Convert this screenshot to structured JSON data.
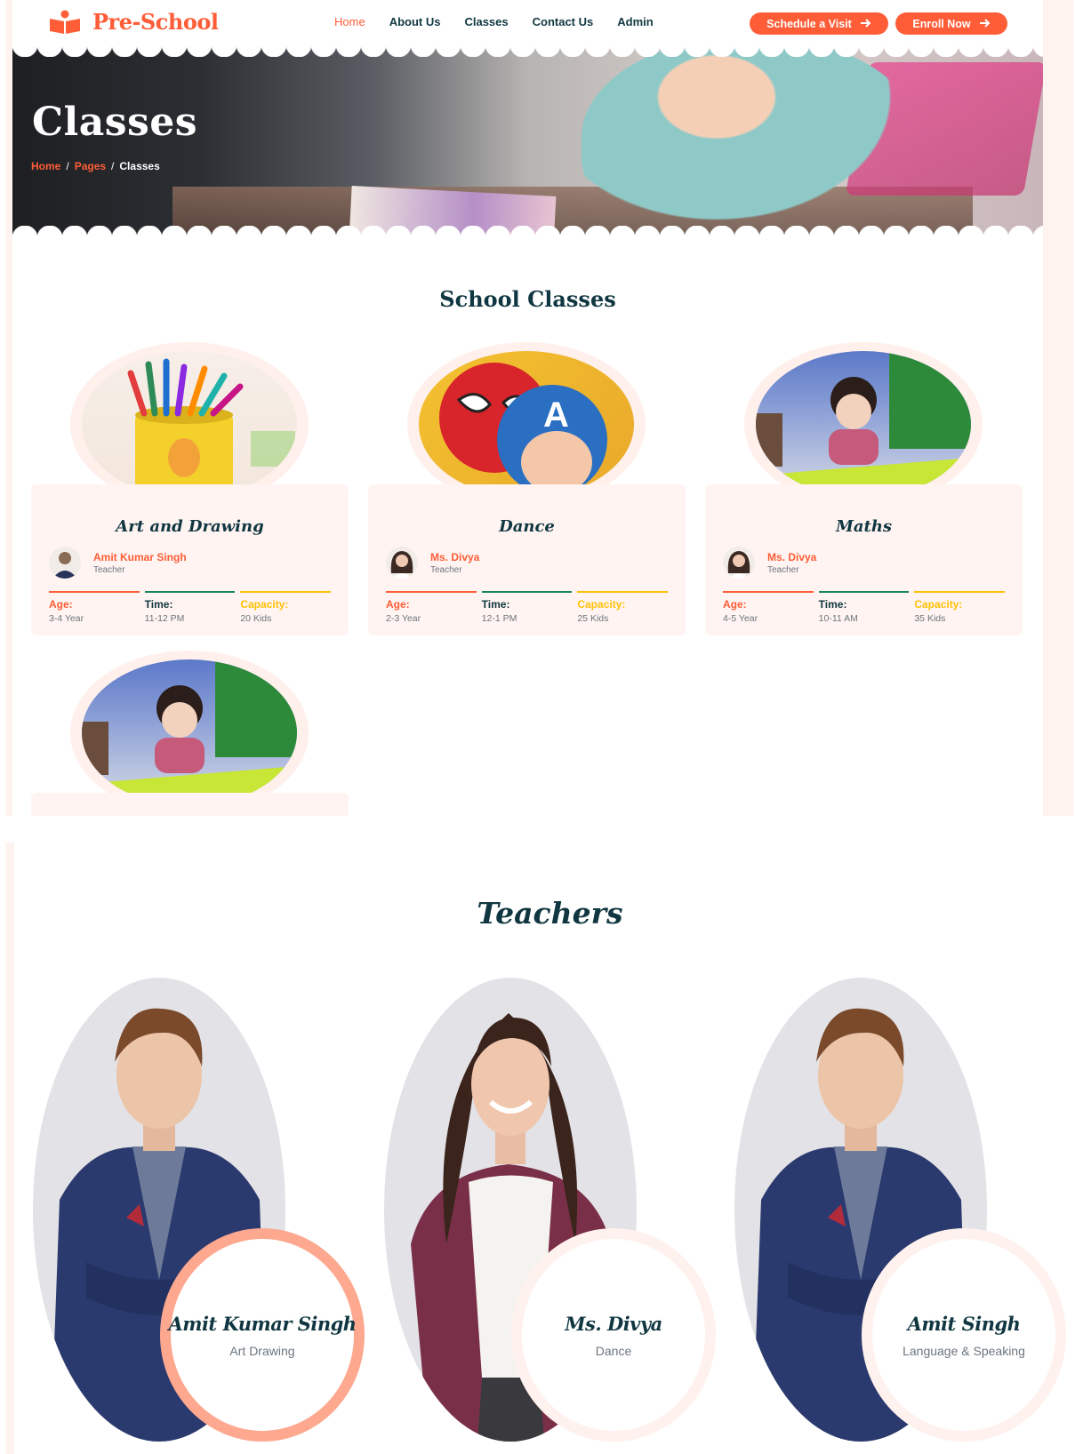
{
  "brand": {
    "name": "Pre-School",
    "accent": "#fe5d37",
    "dark": "#103741"
  },
  "nav": {
    "items": [
      {
        "label": "Home",
        "active": true
      },
      {
        "label": "About Us"
      },
      {
        "label": "Classes"
      },
      {
        "label": "Contact Us"
      },
      {
        "label": "Admin"
      }
    ],
    "schedule_label": "Schedule a Visit",
    "enroll_label": "Enroll Now"
  },
  "hero": {
    "title": "Classes",
    "breadcrumb": [
      "Home",
      "Pages",
      "Classes"
    ]
  },
  "classes_section": {
    "title": "School Classes",
    "stat_labels": {
      "age": "Age:",
      "time": "Time:",
      "capacity": "Capacity:"
    },
    "items": [
      {
        "name": "Art and Drawing",
        "teacher": "Amit Kumar Singh",
        "role": "Teacher",
        "age": "3-4 Year",
        "time": "11-12 PM",
        "capacity": "20 Kids"
      },
      {
        "name": "Dance",
        "teacher": "Ms. Divya",
        "role": "Teacher",
        "age": "2-3 Year",
        "time": "12-1 PM",
        "capacity": "25 Kids"
      },
      {
        "name": "Maths",
        "teacher": "Ms. Divya",
        "role": "Teacher",
        "age": "4-5 Year",
        "time": "10-11 AM",
        "capacity": "35 Kids"
      }
    ]
  },
  "teachers_section": {
    "title": "Teachers",
    "items": [
      {
        "name": "Amit Kumar Singh",
        "subject": "Art Drawing"
      },
      {
        "name": "Ms. Divya",
        "subject": "Dance"
      },
      {
        "name": "Amit Singh",
        "subject": "Language & Speaking"
      }
    ]
  }
}
